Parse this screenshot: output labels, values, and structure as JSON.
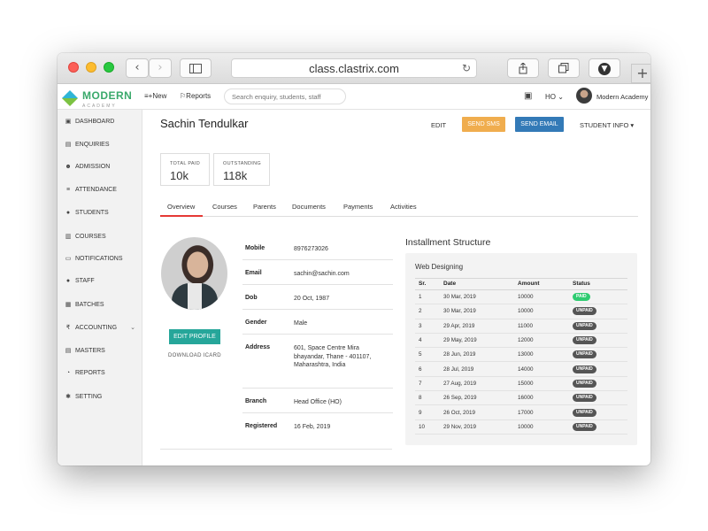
{
  "browser": {
    "url": "class.clastrix.com",
    "back_glyph": "‹",
    "forward_glyph": "›",
    "reload_glyph": "↻",
    "new_tab_glyph": "+"
  },
  "app": {
    "logo_text": "MODERN",
    "logo_sub": "ACADEMY",
    "nav_new": "New",
    "nav_reports": "Reports",
    "search_placeholder": "Search enquiry, students, staff",
    "branch": "HO",
    "org_name": "Modern Academy"
  },
  "sidebar": {
    "items": [
      {
        "label": "DASHBOARD",
        "icon": "dashboard-icon",
        "glyph": "▣"
      },
      {
        "label": "ENQUIRIES",
        "icon": "document-icon",
        "glyph": "▤"
      },
      {
        "label": "ADMISSION",
        "icon": "users-icon",
        "glyph": "☻"
      },
      {
        "label": "ATTENDANCE",
        "icon": "user-check-icon",
        "glyph": "≡"
      },
      {
        "label": "STUDENTS",
        "icon": "user-icon",
        "glyph": "●"
      },
      {
        "label": "COURSES",
        "icon": "book-icon",
        "glyph": "▥"
      },
      {
        "label": "NOTIFICATIONS",
        "icon": "message-icon",
        "glyph": "▭"
      },
      {
        "label": "STAFF",
        "icon": "user-icon",
        "glyph": "●"
      },
      {
        "label": "BATCHES",
        "icon": "batches-icon",
        "glyph": "▦"
      },
      {
        "label": "ACCOUNTING",
        "icon": "rupee-icon",
        "glyph": "₹"
      },
      {
        "label": "MASTERS",
        "icon": "masters-icon",
        "glyph": "▤"
      },
      {
        "label": "REPORTS",
        "icon": "pie-chart-icon",
        "glyph": "◔"
      },
      {
        "label": "SETTING",
        "icon": "gear-icon",
        "glyph": "✱"
      }
    ]
  },
  "student": {
    "name": "Sachin Tendulkar",
    "actions": {
      "edit": "EDIT",
      "send_sms": "SEND SMS",
      "send_email": "SEND EMAIL",
      "student_info": "STUDENT INFO ▾"
    },
    "stats": {
      "total_paid_label": "TOTAL PAID",
      "total_paid_value": "10k",
      "outstanding_label": "OUTSTANDING",
      "outstanding_value": "118k"
    },
    "tabs": [
      "Overview",
      "Courses",
      "Parents",
      "Documents",
      "Payments",
      "Activities"
    ],
    "edit_profile": "EDIT PROFILE",
    "download_icard": "DOWNLOAD ICARD",
    "details": [
      {
        "label": "Mobile",
        "value": "8976273026"
      },
      {
        "label": "Email",
        "value": "sachin@sachin.com"
      },
      {
        "label": "Dob",
        "value": "20 Oct, 1987"
      },
      {
        "label": "Gender",
        "value": "Male"
      },
      {
        "label": "Address",
        "value": "601, Space Centre Mira bhayandar, Thane - 401107, Maharashtra, India"
      },
      {
        "label": "Branch",
        "value": "Head Office (HO)"
      },
      {
        "label": "Registered",
        "value": "16 Feb, 2019"
      }
    ]
  },
  "installments": {
    "title": "Installment Structure",
    "course": "Web Designing",
    "columns": [
      "Sr.",
      "Date",
      "Amount",
      "Status"
    ],
    "rows": [
      {
        "sr": "1",
        "date": "30 Mar, 2019",
        "amount": "10000",
        "status": "PAID"
      },
      {
        "sr": "2",
        "date": "30 Mar, 2019",
        "amount": "10000",
        "status": "UNPAID"
      },
      {
        "sr": "3",
        "date": "29 Apr, 2019",
        "amount": "11000",
        "status": "UNPAID"
      },
      {
        "sr": "4",
        "date": "29 May, 2019",
        "amount": "12000",
        "status": "UNPAID"
      },
      {
        "sr": "5",
        "date": "28 Jun, 2019",
        "amount": "13000",
        "status": "UNPAID"
      },
      {
        "sr": "6",
        "date": "28 Jul, 2019",
        "amount": "14000",
        "status": "UNPAID"
      },
      {
        "sr": "7",
        "date": "27 Aug, 2019",
        "amount": "15000",
        "status": "UNPAID"
      },
      {
        "sr": "8",
        "date": "26 Sep, 2019",
        "amount": "16000",
        "status": "UNPAID"
      },
      {
        "sr": "9",
        "date": "26 Oct, 2019",
        "amount": "17000",
        "status": "UNPAID"
      },
      {
        "sr": "10",
        "date": "29 Nov, 2019",
        "amount": "10000",
        "status": "UNPAID"
      }
    ]
  },
  "colors": {
    "sms": "#f0ad4e",
    "email": "#337ab7",
    "edit_profile": "#26a69a",
    "paid": "#2ecc71",
    "unpaid": "#555555",
    "active_tab": "#e53935"
  }
}
